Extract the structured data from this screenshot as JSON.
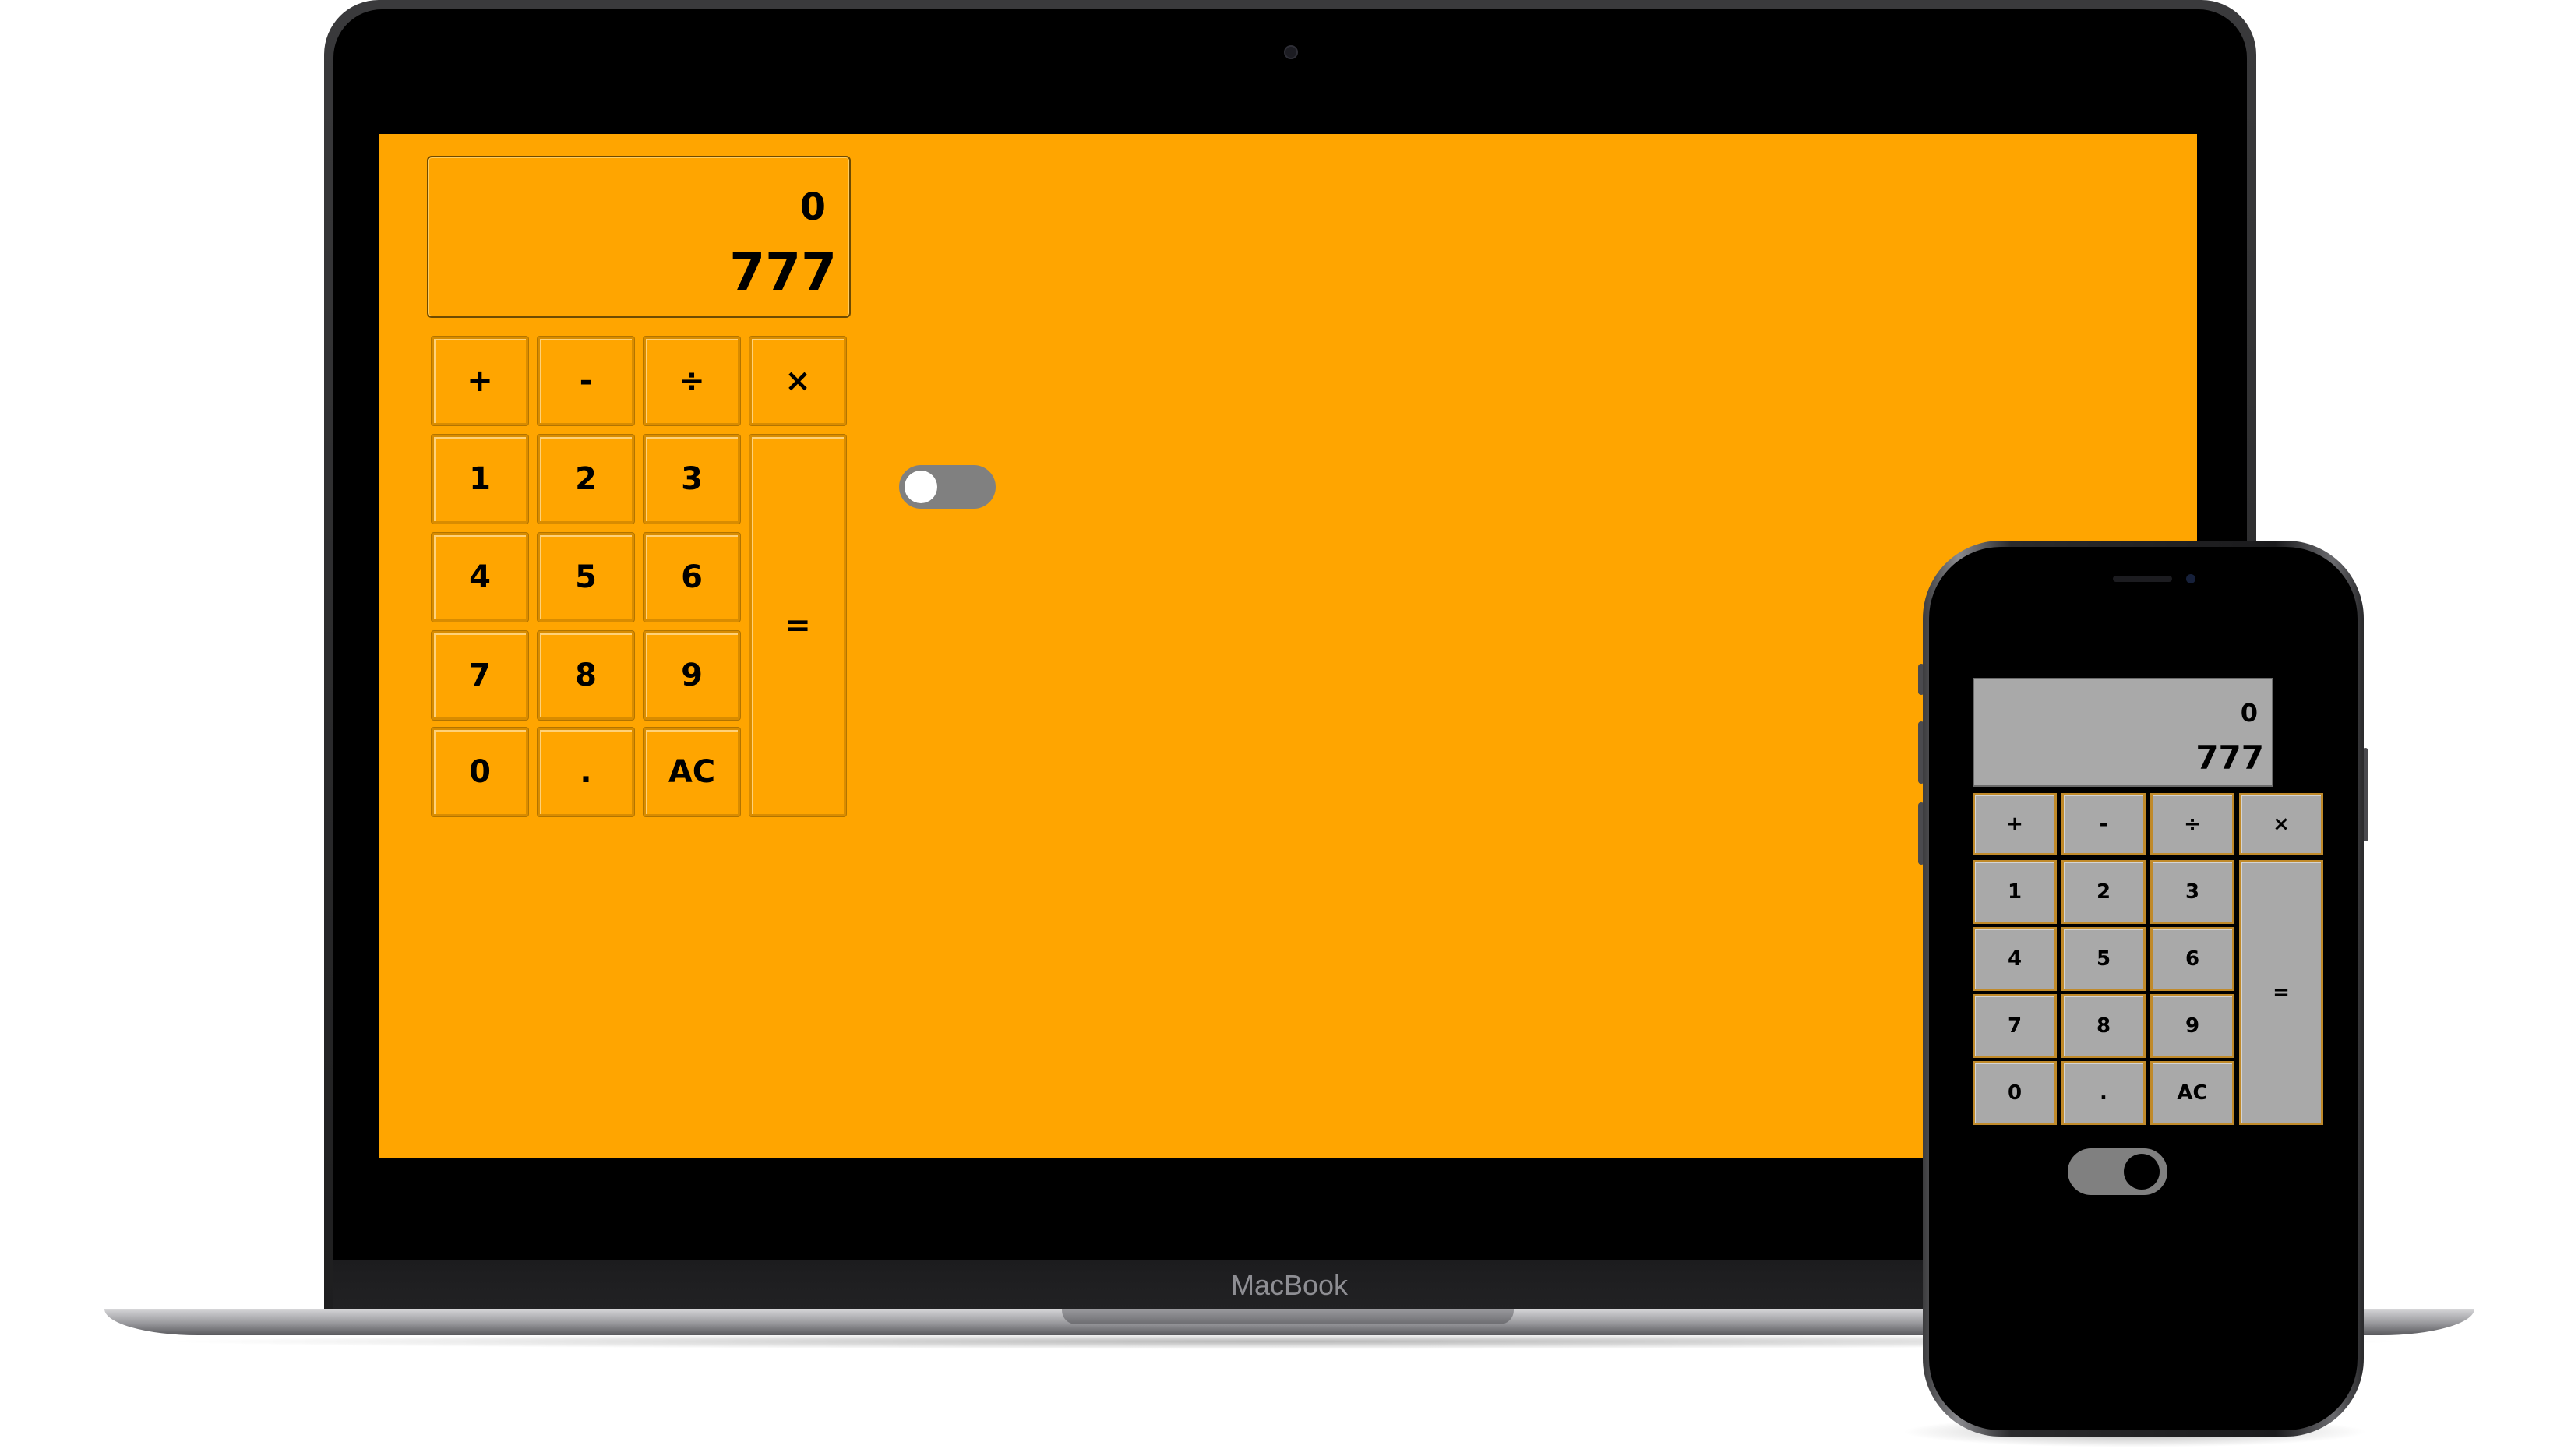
{
  "laptop": {
    "brand": "MacBook",
    "theme_color": "#ffa500",
    "calculator": {
      "previous_value": "0",
      "current_value": "777",
      "keys": {
        "plus": "+",
        "minus": "-",
        "divide": "÷",
        "multiply": "×",
        "one": "1",
        "two": "2",
        "three": "3",
        "four": "4",
        "five": "5",
        "six": "6",
        "seven": "7",
        "eight": "8",
        "nine": "9",
        "zero": "0",
        "dot": ".",
        "clear": "AC",
        "equals": "="
      }
    },
    "theme_toggle": {
      "state": "off"
    }
  },
  "phone": {
    "theme_color": "#000000",
    "calculator": {
      "previous_value": "0",
      "current_value": "777",
      "keys": {
        "plus": "+",
        "minus": "-",
        "divide": "÷",
        "multiply": "×",
        "one": "1",
        "two": "2",
        "three": "3",
        "four": "4",
        "five": "5",
        "six": "6",
        "seven": "7",
        "eight": "8",
        "nine": "9",
        "zero": "0",
        "dot": ".",
        "clear": "AC",
        "equals": "="
      }
    },
    "theme_toggle": {
      "state": "on"
    }
  }
}
